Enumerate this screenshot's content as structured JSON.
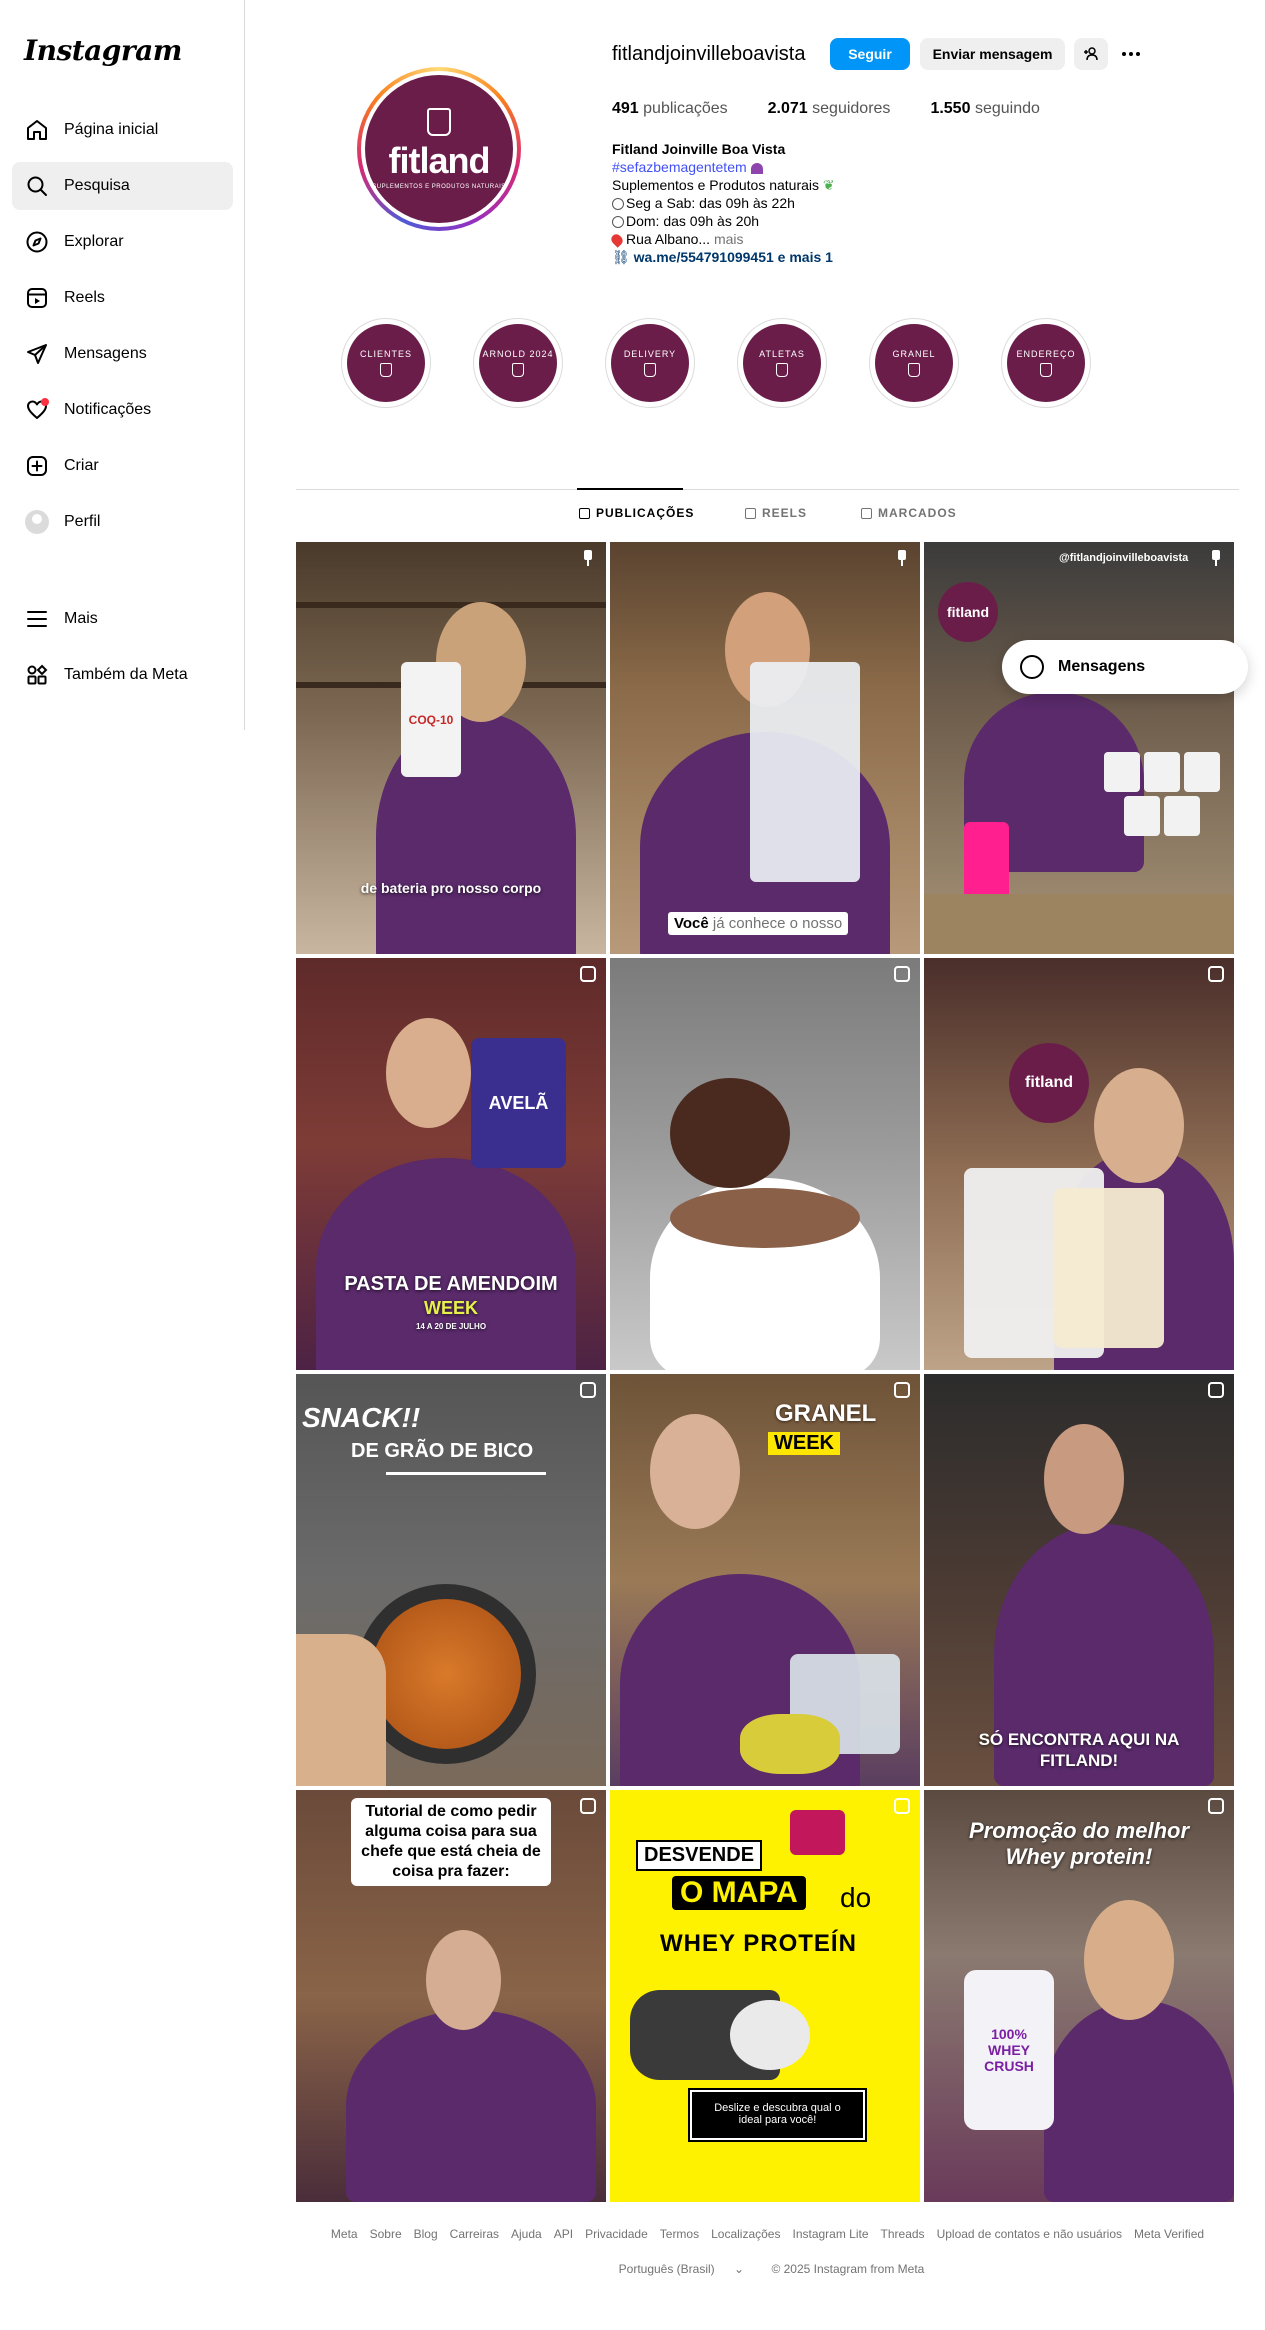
{
  "app": {
    "logo": "Instagram"
  },
  "sidebar": {
    "items": [
      {
        "label": "Página inicial",
        "icon": "home-icon"
      },
      {
        "label": "Pesquisa",
        "icon": "search-icon"
      },
      {
        "label": "Explorar",
        "icon": "explore-icon"
      },
      {
        "label": "Reels",
        "icon": "reels-icon"
      },
      {
        "label": "Mensagens",
        "icon": "messages-icon"
      },
      {
        "label": "Notificações",
        "icon": "heart-icon"
      },
      {
        "label": "Criar",
        "icon": "create-icon"
      },
      {
        "label": "Perfil",
        "icon": "avatar"
      }
    ],
    "active_index": 1,
    "bottom": [
      {
        "label": "Mais",
        "icon": "menu-icon"
      },
      {
        "label": "Também da Meta",
        "icon": "meta-apps-icon"
      }
    ]
  },
  "profile": {
    "username": "fitlandjoinvilleboavista",
    "follow_label": "Seguir",
    "message_label": "Enviar mensagem",
    "avatar_brand": "fitland",
    "avatar_subtitle": "SUPLEMENTOS E PRODUTOS NATURAIS",
    "stats": {
      "posts_count": "491",
      "posts_label": "publicações",
      "followers_count": "2.071",
      "followers_label": "seguidores",
      "following_count": "1.550",
      "following_label": "seguindo"
    },
    "bio": {
      "name": "Fitland Joinville Boa Vista",
      "hashtag": "#sefazbemagentetem",
      "line1": "Suplementos e Produtos naturais",
      "line2": "Seg a Sab: das 09h às 22h",
      "line3": "Dom: das 09h às 20h",
      "line4": "Rua Albano...",
      "more": "mais",
      "link": "wa.me/554791099451 e mais 1"
    }
  },
  "highlights": [
    "CLIENTES",
    "ARNOLD 2024",
    "DELIVERY",
    "ATLETAS",
    "GRANEL",
    "ENDEREÇO"
  ],
  "tabs": [
    {
      "label": "PUBLICAÇÕES"
    },
    {
      "label": "REELS"
    },
    {
      "label": "MARCADOS"
    }
  ],
  "posts": [
    {
      "caption": "de bateria pro nosso corpo",
      "product": "COQ-10"
    },
    {
      "caption_bold": "Você",
      "caption": "já conhece o nosso"
    },
    {
      "caption": "",
      "watermark": "@fitlandjoinvilleboavista"
    },
    {
      "title": "PASTA DE AMENDOIM",
      "subtitle": "WEEK",
      "date": "14 A 20 DE JULHO",
      "product": "AVELÃ"
    },
    {
      "caption": ""
    },
    {
      "caption": ""
    },
    {
      "title": "SNACK!!",
      "subtitle": "DE GRÃO DE BICO"
    },
    {
      "title": "GRANEL",
      "subtitle": "WEEK"
    },
    {
      "caption": "SÓ ENCONTRA AQUI NA FITLAND!"
    },
    {
      "caption": "Tutorial de como pedir alguma coisa para sua chefe que está cheia de coisa pra fazer:"
    },
    {
      "title": "DESVENDE",
      "title2": "O MAPA",
      "title3": "do",
      "subtitle": "WHEY PROTEÍN",
      "cta": "Deslize e descubra qual o ideal para você!"
    },
    {
      "title": "Promoção do melhor Whey protein!",
      "product": "100% WHEY CRUSH"
    }
  ],
  "floating_messages": {
    "label": "Mensagens"
  },
  "footer": {
    "links": [
      "Meta",
      "Sobre",
      "Blog",
      "Carreiras",
      "Ajuda",
      "API",
      "Privacidade",
      "Termos",
      "Localizações",
      "Instagram Lite",
      "Threads",
      "Upload de contatos e não usuários",
      "Meta Verified"
    ],
    "language": "Português (Brasil)",
    "copyright": "© 2025 Instagram from Meta"
  },
  "colors": {
    "accent": "#0095f6",
    "brand": "#6b1d4a",
    "notification": "#ff3040"
  }
}
